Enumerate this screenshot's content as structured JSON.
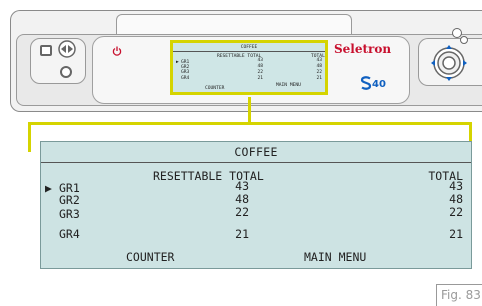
{
  "brand": {
    "name": "Seletron",
    "model": "40"
  },
  "colors": {
    "callout": "#d5d400",
    "display_bg": "#cde3e3",
    "brand_red": "#c8102e",
    "model_blue": "#1060c0"
  },
  "display": {
    "title": "COFFEE",
    "col_resettable": "RESETTABLE TOTAL",
    "col_total": "TOTAL",
    "cursor_glyph": "▶",
    "rows": [
      {
        "label": "GR1",
        "resettable": "43",
        "total": "43"
      },
      {
        "label": "GR2",
        "resettable": "48",
        "total": "48"
      },
      {
        "label": "GR3",
        "resettable": "22",
        "total": "22"
      },
      {
        "label": "GR4",
        "resettable": "21",
        "total": "21"
      }
    ],
    "footer_left": "COUNTER",
    "footer_right": "MAIN MENU"
  },
  "figure": {
    "label": "Fig. 83"
  },
  "icons": {
    "left_arrows": "left-right-arrows-icon",
    "power": "power-icon",
    "dpad": "dpad-icon",
    "brand_s": "brand-s-icon"
  }
}
